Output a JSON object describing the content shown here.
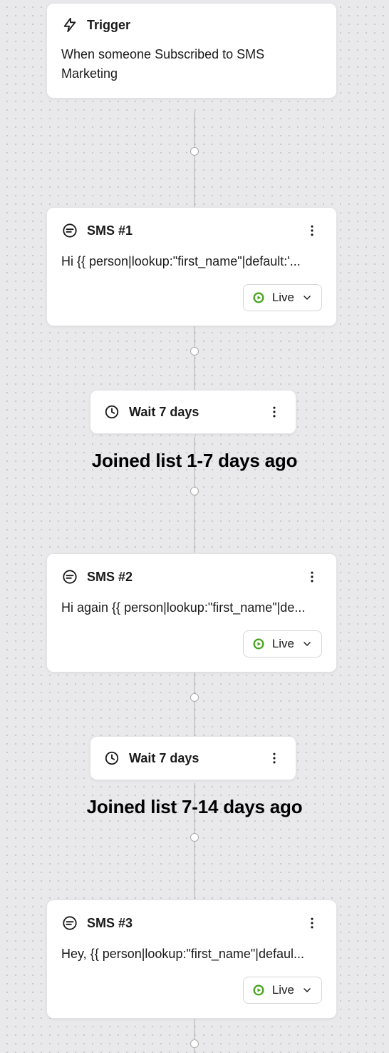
{
  "trigger": {
    "title": "Trigger",
    "description": "When someone Subscribed to SMS Marketing"
  },
  "nodes": {
    "sms1": {
      "title": "SMS #1",
      "body": "Hi {{ person|lookup:\"first_name\"|default:'...",
      "status": "Live"
    },
    "wait1": {
      "title": "Wait 7 days"
    },
    "sms2": {
      "title": "SMS #2",
      "body": "Hi again {{ person|lookup:\"first_name\"|de...",
      "status": "Live"
    },
    "wait2": {
      "title": "Wait 7 days"
    },
    "sms3": {
      "title": "SMS #3",
      "body": "Hey, {{ person|lookup:\"first_name\"|defaul...",
      "status": "Live"
    }
  },
  "annotations": {
    "a1": "Joined list 1-7 days ago",
    "a2": "Joined list 7-14 days ago"
  }
}
